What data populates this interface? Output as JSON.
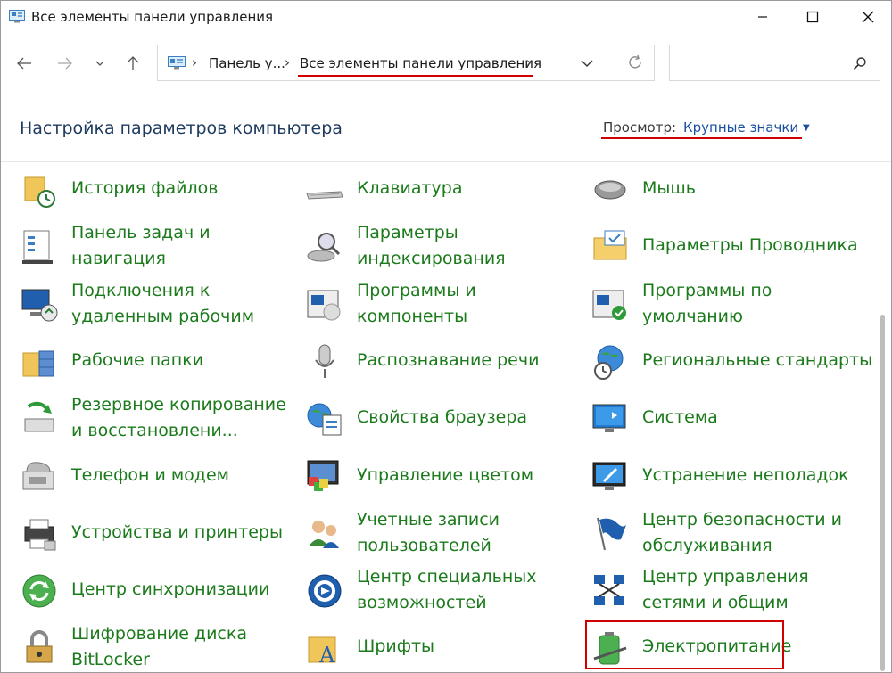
{
  "window": {
    "title": "Все элементы панели управления"
  },
  "breadcrumb": {
    "parent": "Панель у...",
    "current": "Все элементы панели управления"
  },
  "header": {
    "title": "Настройка параметров компьютера",
    "view_label": "Просмотр:",
    "view_value": "Крупные значки"
  },
  "items": [
    {
      "label": "История файлов",
      "icon": "file-history-icon"
    },
    {
      "label": "Клавиатура",
      "icon": "keyboard-icon"
    },
    {
      "label": "Мышь",
      "icon": "mouse-icon"
    },
    {
      "label": "Панель задач и\nнавигация",
      "icon": "taskbar-icon"
    },
    {
      "label": "Параметры\nиндексирования",
      "icon": "indexing-icon"
    },
    {
      "label": "Параметры Проводника",
      "icon": "explorer-options-icon"
    },
    {
      "label": "Подключения к\nудаленным рабочим",
      "icon": "remote-desktop-icon"
    },
    {
      "label": "Программы и\nкомпоненты",
      "icon": "programs-icon"
    },
    {
      "label": "Программы по\nумолчанию",
      "icon": "default-programs-icon"
    },
    {
      "label": "Рабочие папки",
      "icon": "work-folders-icon"
    },
    {
      "label": "Распознавание речи",
      "icon": "microphone-icon"
    },
    {
      "label": "Региональные стандарты",
      "icon": "region-icon"
    },
    {
      "label": "Резервное копирование\nи восстановлени...",
      "icon": "backup-icon"
    },
    {
      "label": "Свойства браузера",
      "icon": "internet-options-icon"
    },
    {
      "label": "Система",
      "icon": "system-icon"
    },
    {
      "label": "Телефон и модем",
      "icon": "phone-modem-icon"
    },
    {
      "label": "Управление цветом",
      "icon": "color-management-icon"
    },
    {
      "label": "Устранение неполадок",
      "icon": "troubleshooting-icon"
    },
    {
      "label": "Устройства и принтеры",
      "icon": "printer-icon"
    },
    {
      "label": "Учетные записи\nпользователей",
      "icon": "user-accounts-icon"
    },
    {
      "label": "Центр безопасности и\nобслуживания",
      "icon": "security-flag-icon"
    },
    {
      "label": "Центр синхронизации",
      "icon": "sync-icon"
    },
    {
      "label": "Центр специальных\nвозможностей",
      "icon": "accessibility-icon"
    },
    {
      "label": "Центр управления\nсетями и общим",
      "icon": "network-icon"
    },
    {
      "label": "Шифрование диска\nBitLocker",
      "icon": "bitlocker-icon"
    },
    {
      "label": "Шрифты",
      "icon": "fonts-icon"
    },
    {
      "label": "Электропитание",
      "icon": "power-battery-icon"
    }
  ],
  "colors": {
    "item_text": "#1b7a1b",
    "title_text": "#1e3a5f",
    "link": "#1a4fa0",
    "annotation_red": "#d00000"
  }
}
